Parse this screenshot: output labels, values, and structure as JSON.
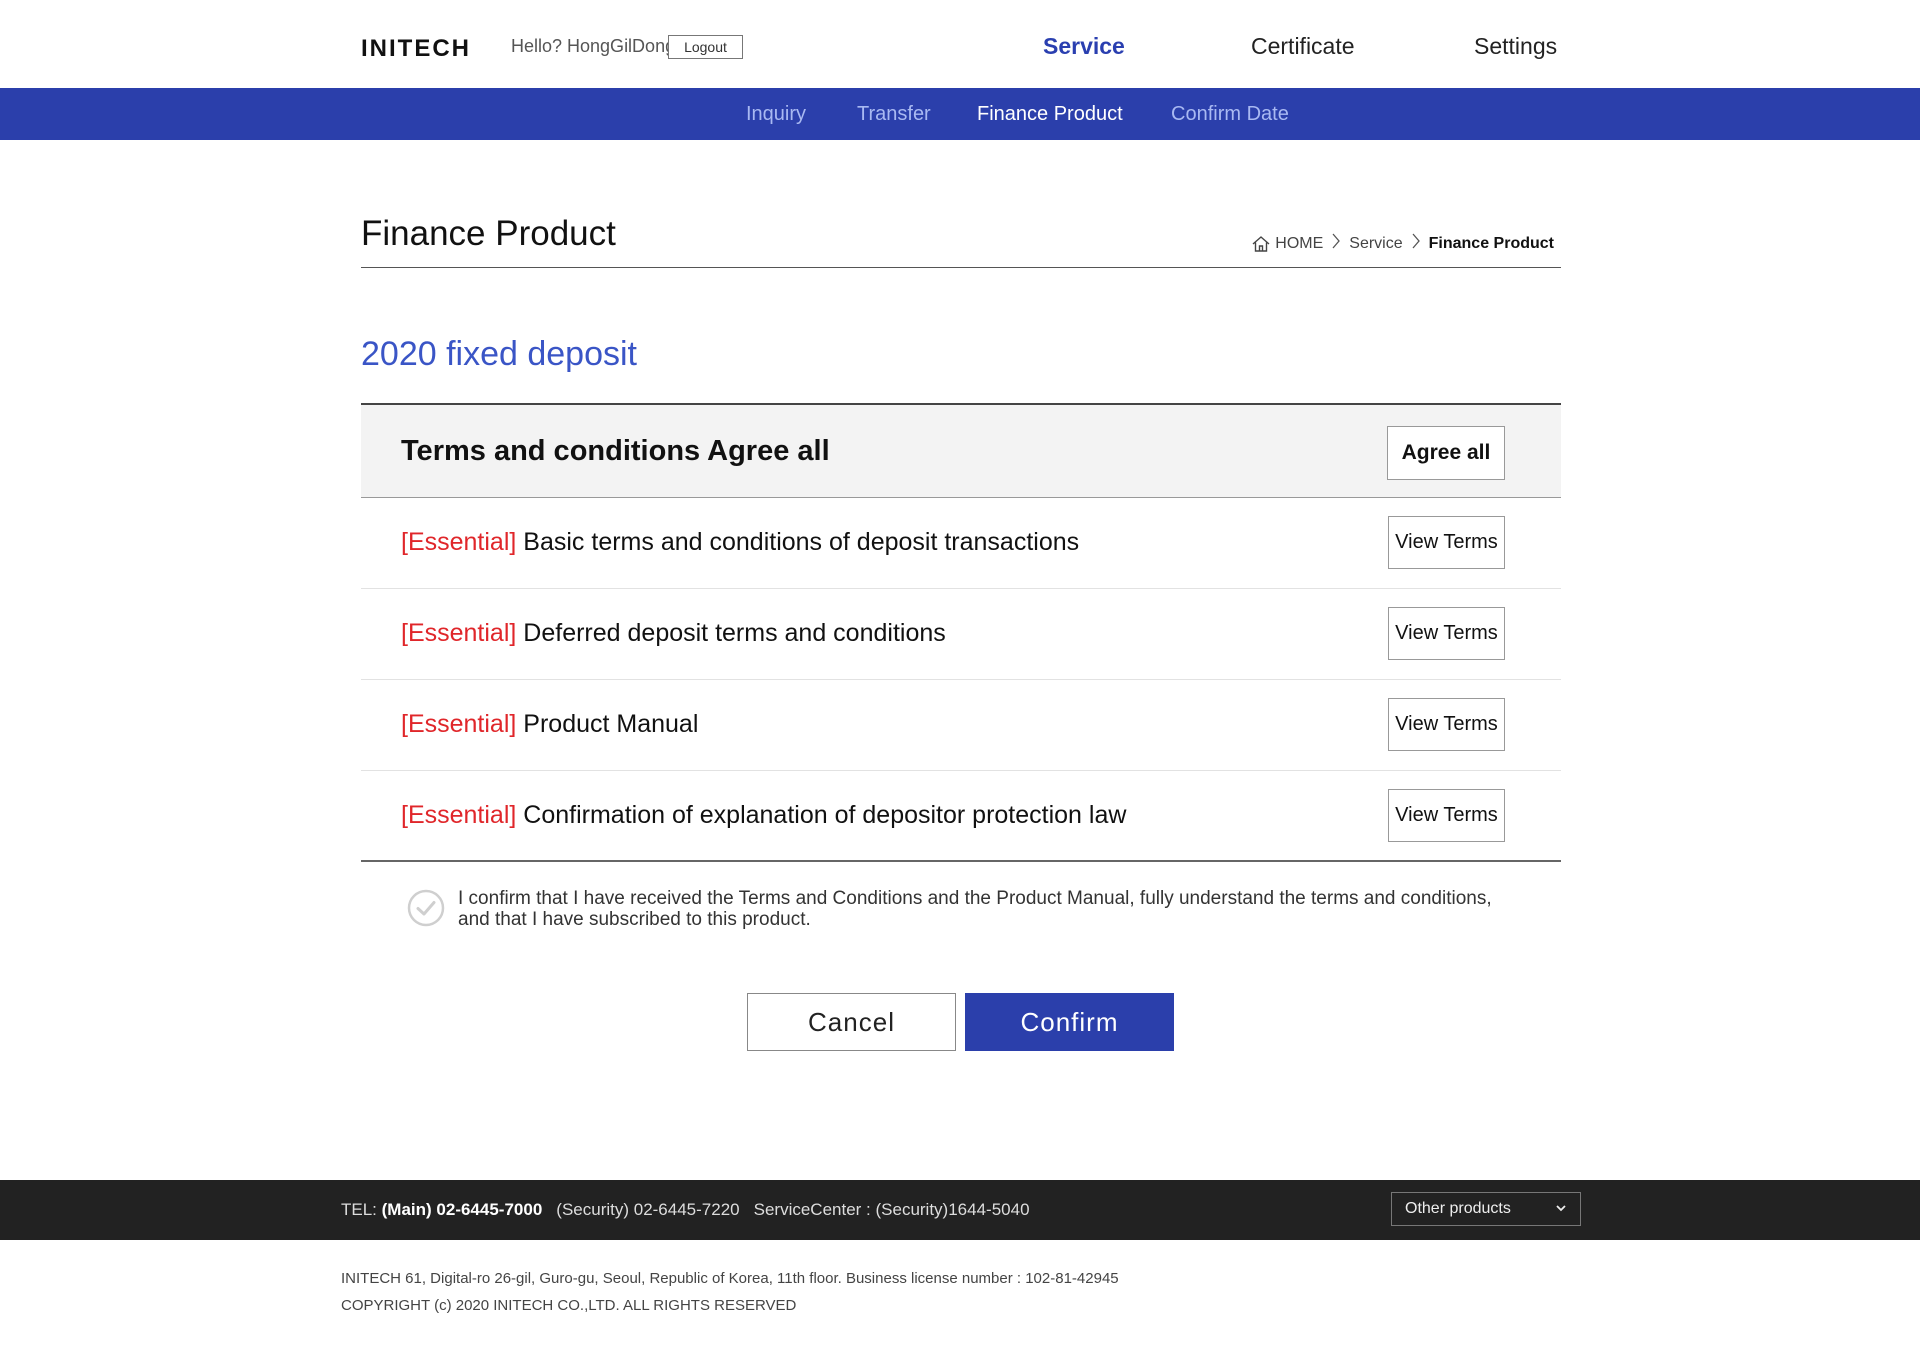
{
  "header": {
    "logo_text": "INITECH",
    "greeting": "Hello? HongGilDong",
    "logout_label": "Logout",
    "nav": [
      {
        "label": "Service",
        "active": true
      },
      {
        "label": "Certificate",
        "active": false
      },
      {
        "label": "Settings",
        "active": false
      }
    ]
  },
  "subnav": {
    "items": [
      {
        "label": "Inquiry",
        "active": false
      },
      {
        "label": "Transfer",
        "active": false
      },
      {
        "label": "Finance Product",
        "active": true
      },
      {
        "label": "Confirm Date",
        "active": false
      }
    ]
  },
  "page": {
    "title": "Finance Product",
    "breadcrumb": [
      "HOME",
      "Service",
      "Finance Product"
    ],
    "product_name": "2020 fixed deposit"
  },
  "terms": {
    "header_label": "Terms and conditions Agree all",
    "agree_all_label": "Agree all",
    "tag": "[Essential]",
    "view_label": "View Terms",
    "items": [
      {
        "text": "Basic terms and conditions of deposit transactions"
      },
      {
        "text": "Deferred deposit terms and conditions"
      },
      {
        "text": "Product Manual"
      },
      {
        "text": "Confirmation of explanation of depositor protection law"
      }
    ]
  },
  "confirmation": {
    "line1": "I confirm that I have received the Terms and Conditions and the Product Manual, fully understand the terms and conditions,",
    "line2": "and that I have subscribed to this product.",
    "checked": false
  },
  "actions": {
    "cancel_label": "Cancel",
    "confirm_label": "Confirm"
  },
  "footer": {
    "tel_label": "TEL:",
    "main_phone": "(Main) 02-6445-7000",
    "security_phone": "(Security) 02-6445-7220",
    "service_center": "ServiceCenter : (Security)1644-5040",
    "other_products_label": "Other products",
    "address": "INITECH 61, Digital-ro 26-gil, Guro-gu, Seoul, Republic of Korea, 11th floor. Business license number : 102-81-42945",
    "copyright": "COPYRIGHT (c) 2020 INITECH CO.,LTD. ALL RIGHTS RESERVED"
  },
  "colors": {
    "brand_blue": "#2b3fab",
    "accent_blue": "#3a55c6",
    "essential_red": "#e0262a",
    "footer_dark": "#222222"
  }
}
